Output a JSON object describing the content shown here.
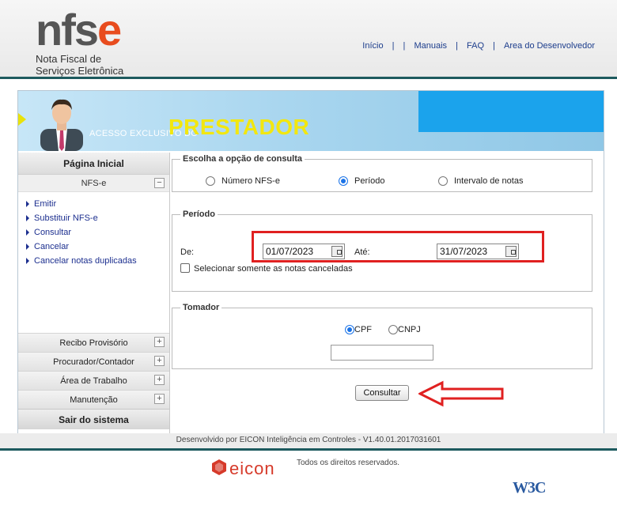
{
  "header": {
    "logo_word_a": "nfs",
    "logo_word_b": "e",
    "logo_sub_1": "Nota Fiscal de",
    "logo_sub_2": "Serviços Eletrônica",
    "nav": [
      "Início",
      "Manuais",
      "FAQ",
      "Area do Desenvolvedor"
    ],
    "nav_sep": "|"
  },
  "banner": {
    "small": "ACESSO EXCLUSIVO DO",
    "big": "PRESTADOR"
  },
  "sidebar": {
    "home": "Página Inicial",
    "nfse": "NFS-e",
    "links": [
      "Emitir",
      "Substituir NFS-e",
      "Consultar",
      "Cancelar",
      "Cancelar notas duplicadas"
    ],
    "groups": [
      "Recibo Provisório",
      "Procurador/Contador",
      "Área de Trabalho",
      "Manutenção"
    ],
    "exit": "Sair do sistema",
    "toggle_minus": "−",
    "toggle_plus": "+"
  },
  "consulta": {
    "legend": "Escolha a opção de consulta",
    "options": [
      "Número NFS-e",
      "Período",
      "Intervalo de notas"
    ],
    "selected": "Período"
  },
  "periodo": {
    "legend": "Período",
    "from_label": "De:",
    "from_value": "01/07/2023",
    "to_label": "Até:",
    "to_value": "31/07/2023",
    "only_canceled": "Selecionar somente as notas canceladas"
  },
  "tomador": {
    "legend": "Tomador",
    "cpf": "CPF",
    "cnpj": "CNPJ",
    "selected": "CPF",
    "value": ""
  },
  "action": {
    "consultar": "Consultar"
  },
  "footer": {
    "dev": "Desenvolvido por EICON Inteligência em Controles - V1.40.01.2017031601",
    "brand": "eicon",
    "rights": "Todos os direitos reservados.",
    "w3c": "W3C"
  },
  "colors": {
    "accent": "#e84c1e",
    "banner_yellow": "#f2e70f",
    "highlight": "#e02020",
    "nav_blue": "#1c3d8c"
  }
}
